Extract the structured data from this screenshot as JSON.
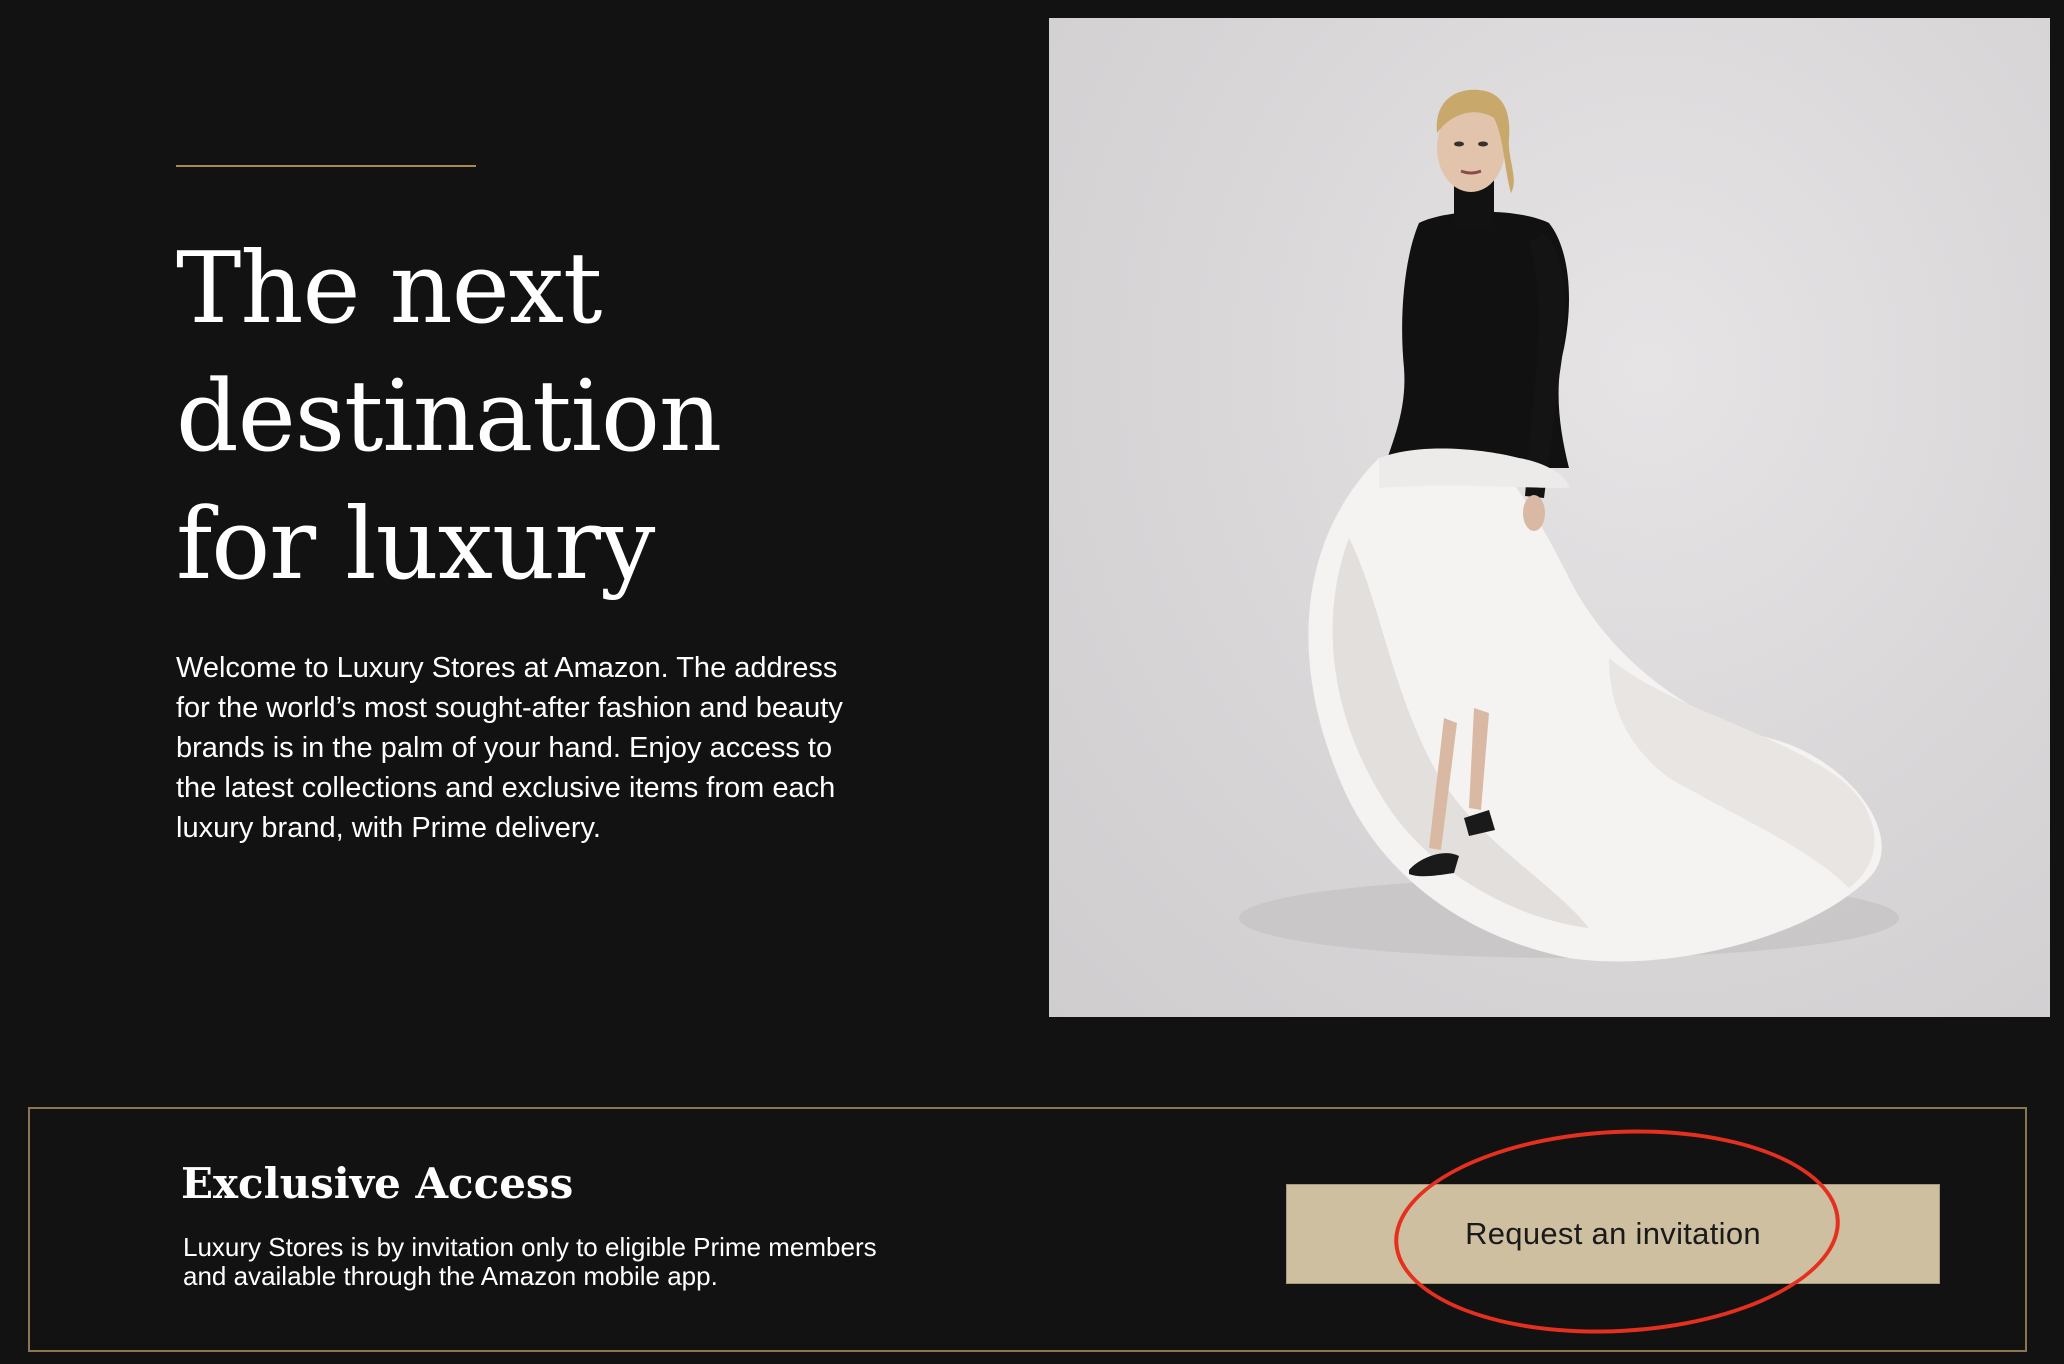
{
  "hero": {
    "headline_lines": [
      "The next",
      "destination",
      "for luxury"
    ],
    "intro": "Welcome to Luxury Stores at Amazon. The address for the world’s most sought-after fashion and beauty brands is in the palm of your hand. Enjoy access to the latest collections and exclusive items from each luxury brand, with Prime delivery.",
    "image_subject": "model-in-black-turtleneck-and-white-feather-gown"
  },
  "access": {
    "title": "Exclusive Access",
    "description": "Luxury Stores is by invitation only to eligible Prime members and available through the Amazon mobile app.",
    "button_label": "Request an invitation"
  },
  "colors": {
    "background": "#121212",
    "gold_accent": "#a8894f",
    "button_fill": "#cdbf9f",
    "annotation_red": "#e5301f"
  }
}
